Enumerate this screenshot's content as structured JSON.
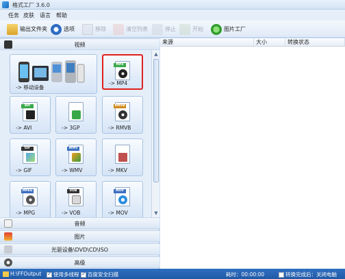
{
  "window": {
    "title": "格式工厂 3.6.0"
  },
  "menu": [
    "任务",
    "皮肤",
    "语言",
    "帮助"
  ],
  "toolbar": {
    "output_folder": "输出文件夹",
    "options": "选项",
    "remove": "移除",
    "clear_list": "清空列表",
    "stop": "停止",
    "start": "开始",
    "picture_factory": "图片工厂"
  },
  "sections": {
    "video": "视频",
    "audio": "音频",
    "picture": "图片",
    "rom": "光驱设备\\DVD\\CD\\ISO",
    "advanced": "高级"
  },
  "tiles": [
    {
      "label": "-> 移动设备",
      "tag": ""
    },
    {
      "label": "-> MP4",
      "tag": "MP4"
    },
    {
      "label": "-> AVI",
      "tag": "AVI"
    },
    {
      "label": "-> 3GP",
      "tag": ""
    },
    {
      "label": "-> RMVB",
      "tag": "RMVB"
    },
    {
      "label": "-> GIF",
      "tag": "GIF"
    },
    {
      "label": "-> WMV",
      "tag": "WMV"
    },
    {
      "label": "-> MKV",
      "tag": ""
    },
    {
      "label": "-> MPG",
      "tag": "MPEG"
    },
    {
      "label": "-> VOB",
      "tag": "VOB"
    },
    {
      "label": "-> MOV",
      "tag": "MOV"
    }
  ],
  "list_columns": {
    "source": "来源",
    "size": "大小",
    "status": "转换状态"
  },
  "status": {
    "output_path": "H:\\FFOutput",
    "multithread": "使用多线程",
    "baidu": "百度安全扫描",
    "elapsed": "耗时：00:00:00",
    "after_done": "转换完成后：关闭电脑"
  },
  "colors": {
    "accent": "#1f5aa6",
    "selected_border": "#e0201c"
  }
}
